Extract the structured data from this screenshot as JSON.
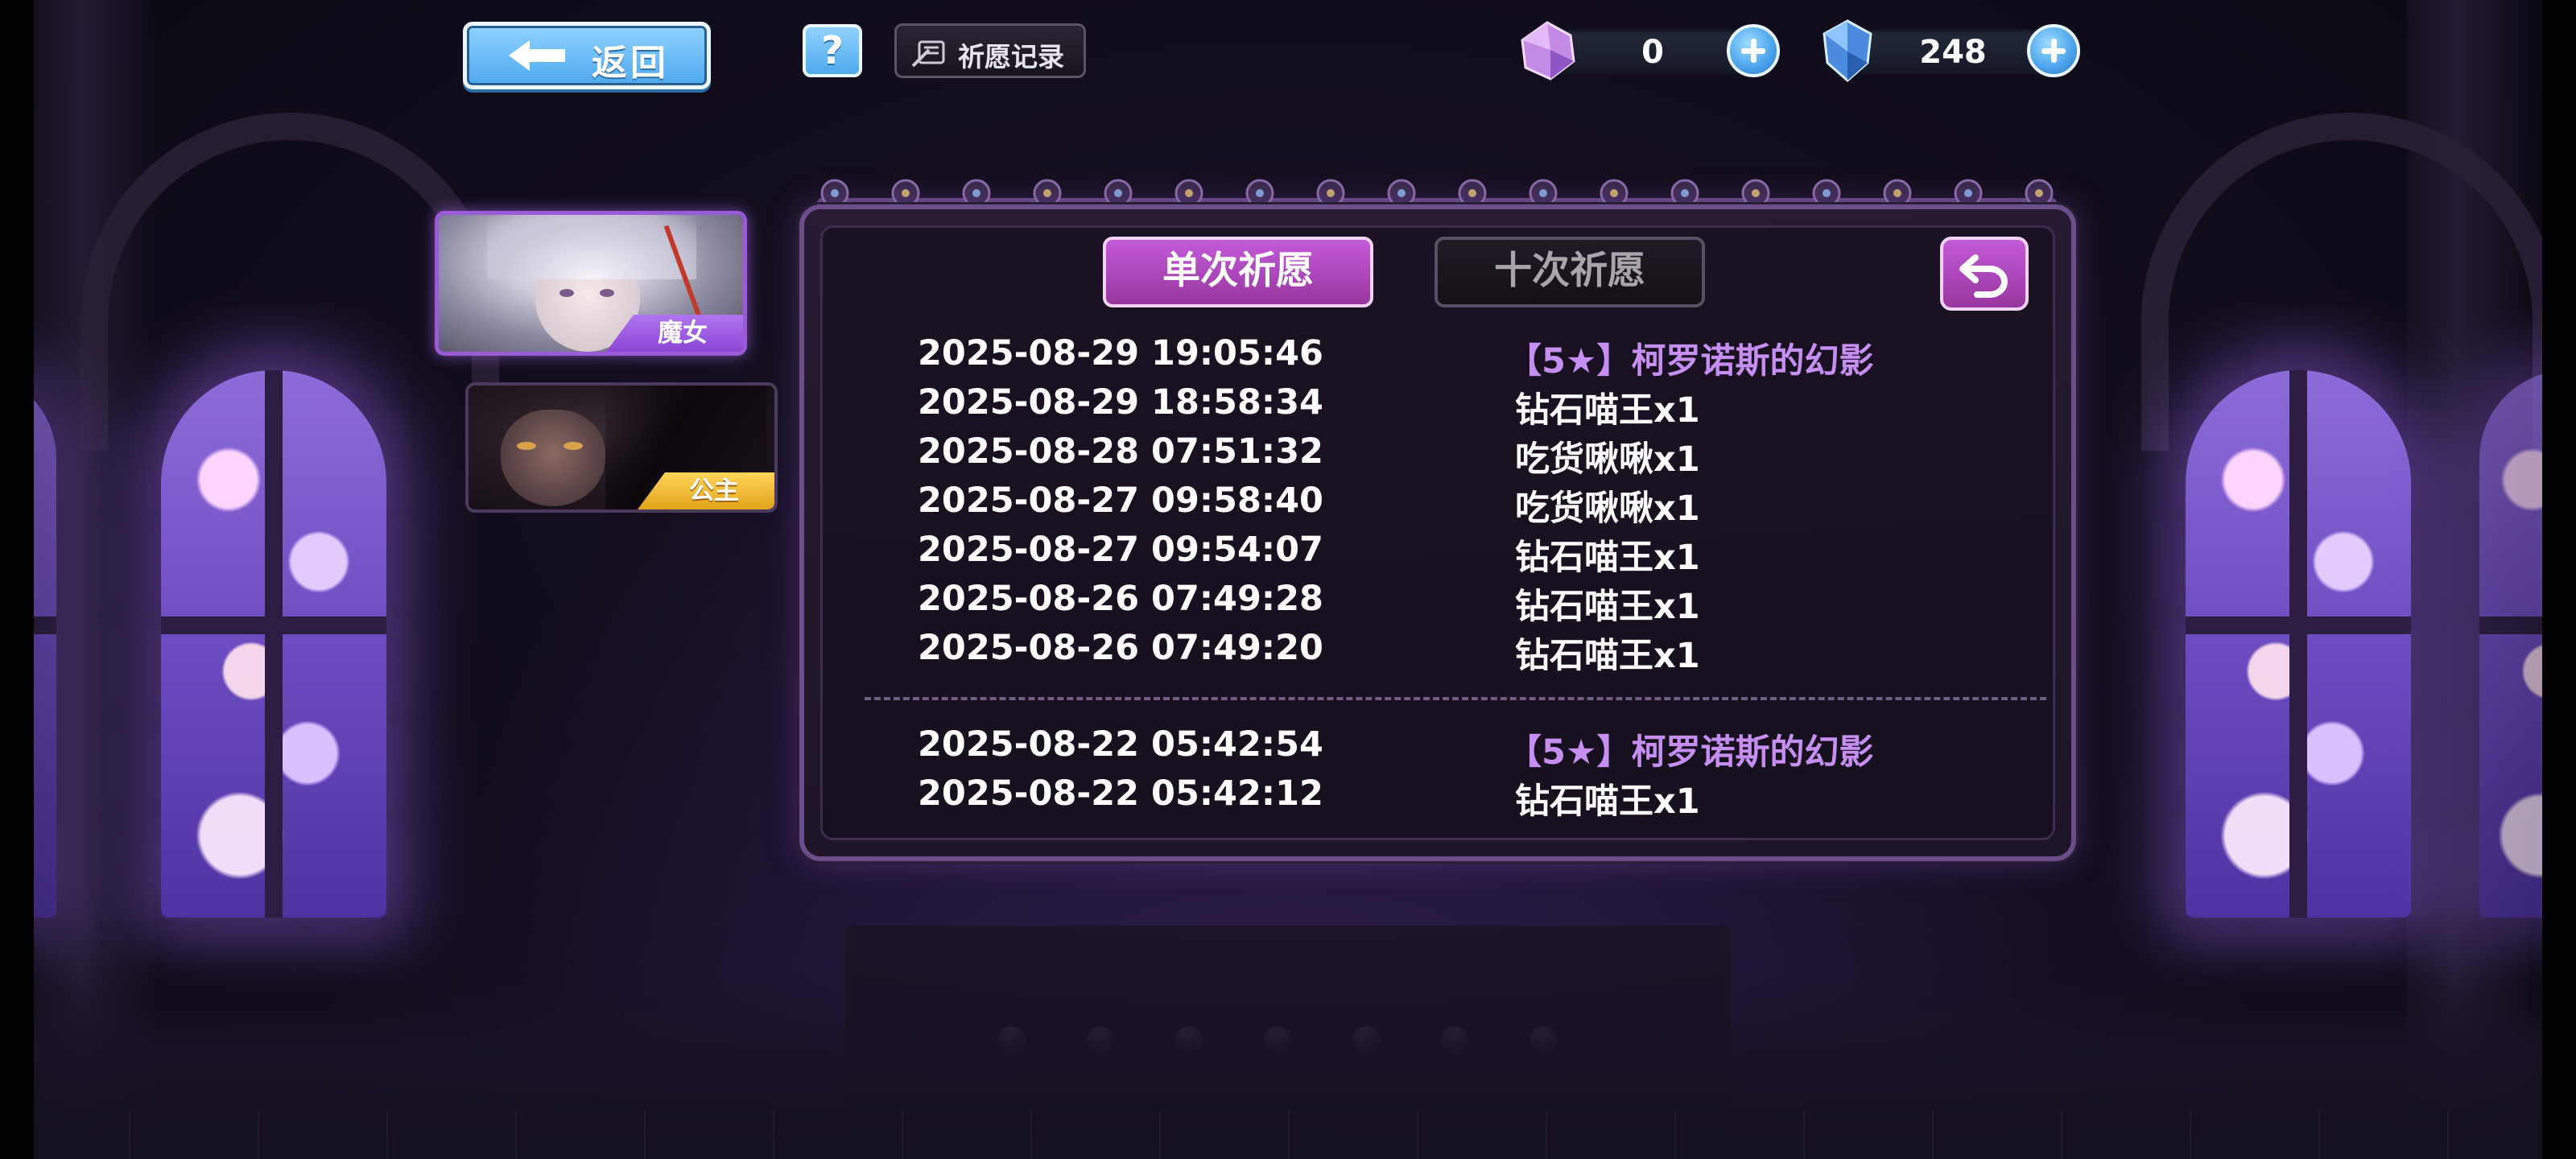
{
  "topbar": {
    "back_label": "返回",
    "help_label": "?",
    "history_label": "祈愿记录"
  },
  "currencies": [
    {
      "icon": "purple-crystal-icon",
      "value": "0"
    },
    {
      "icon": "blue-diamond-icon",
      "value": "248"
    }
  ],
  "characters": [
    {
      "tag": "魔女",
      "selected": true
    },
    {
      "tag": "公主",
      "selected": false
    }
  ],
  "tabs": {
    "single": "单次祈愿",
    "ten": "十次祈愿",
    "active": "single"
  },
  "records": {
    "group1": [
      {
        "time": "2025-08-29 19:05:46",
        "item": "【5★】柯罗诺斯的幻影",
        "rare": true
      },
      {
        "time": "2025-08-29 18:58:34",
        "item": "钻石喵王x1",
        "rare": false
      },
      {
        "time": "2025-08-28 07:51:32",
        "item": "吃货啾啾x1",
        "rare": false
      },
      {
        "time": "2025-08-27 09:58:40",
        "item": "吃货啾啾x1",
        "rare": false
      },
      {
        "time": "2025-08-27 09:54:07",
        "item": "钻石喵王x1",
        "rare": false
      },
      {
        "time": "2025-08-26 07:49:28",
        "item": "钻石喵王x1",
        "rare": false
      },
      {
        "time": "2025-08-26 07:49:20",
        "item": "钻石喵王x1",
        "rare": false
      }
    ],
    "group2": [
      {
        "time": "2025-08-22 05:42:54",
        "item": "【5★】柯罗诺斯的幻影",
        "rare": true
      },
      {
        "time": "2025-08-22 05:42:12",
        "item": "钻石喵王x1",
        "rare": false
      }
    ]
  },
  "colors": {
    "accent_purple": "#a84bc0",
    "rare_text": "#c78ef2",
    "button_blue": "#4ea9ef"
  }
}
